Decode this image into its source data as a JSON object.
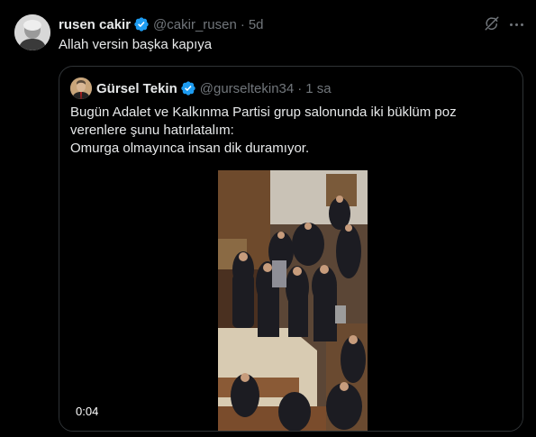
{
  "tweet": {
    "author_name": "rusen cakir",
    "author_handle": "@cakir_rusen",
    "separator": "·",
    "time": "5d",
    "text": "Allah versin başka kapıya"
  },
  "quoted_tweet": {
    "author_name": "Gürsel Tekin",
    "author_handle": "@gurseltekin34",
    "separator": "·",
    "time": "1 sa",
    "text_lines": [
      "Bugün Adalet ve Kalkınma Partisi grup salonunda iki büklüm poz",
      "verenlere şunu hatırlatalım:",
      "Omurga olmayınca insan dik duramıyor."
    ],
    "video": {
      "duration": "0:04"
    }
  },
  "colors": {
    "background": "#000000",
    "text": "#e7e9ea",
    "muted": "#71767b",
    "border": "#2f3336",
    "verified": "#1d9bf0"
  },
  "icons": [
    "verified-badge-icon",
    "grok-icon",
    "more-icon"
  ]
}
